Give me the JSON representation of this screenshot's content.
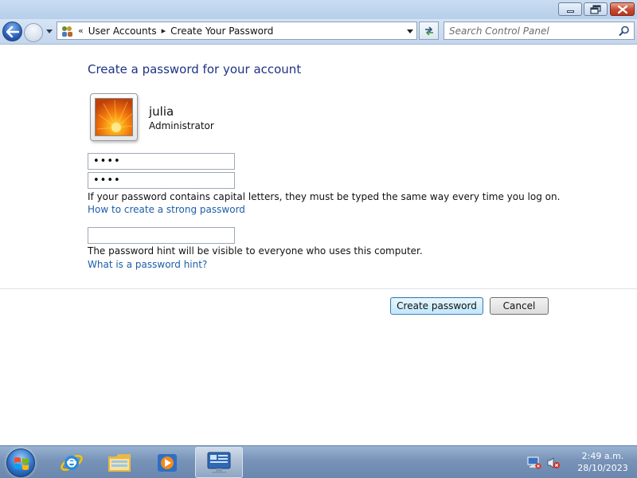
{
  "breadcrumb": {
    "overflow": "«",
    "items": [
      "User Accounts",
      "Create Your Password"
    ],
    "separator": "▸"
  },
  "search": {
    "placeholder": "Search Control Panel"
  },
  "page": {
    "title": "Create a password for your account",
    "username": "julia",
    "role": "Administrator",
    "new_password_value": "••••",
    "confirm_password_value": "••••",
    "hint_value": "",
    "caps_note": "If your password contains capital letters, they must be typed the same way every time you log on.",
    "strong_link": "How to create a strong password",
    "hint_note": "The password hint will be visible to everyone who uses this computer.",
    "hint_link": "What is a password hint?"
  },
  "buttons": {
    "create": "Create password",
    "cancel": "Cancel"
  },
  "clock": {
    "time": "2:49 a.m.",
    "date": "28/10/2023"
  },
  "icons": {
    "back": "back-arrow-icon",
    "forward": "forward-arrow-icon",
    "control_panel": "control-panel-icon",
    "search": "search-icon",
    "refresh": "refresh-icon",
    "start": "windows-logo-icon",
    "ie": "internet-explorer-icon",
    "explorer": "folder-icon",
    "media": "media-player-icon",
    "network": "network-error-icon",
    "volume": "volume-muted-icon"
  },
  "colors": {
    "title_blue": "#1e3287",
    "link_blue": "#1c5ea8",
    "taskbar": "#7893b8",
    "close_button": "#c74a30"
  }
}
